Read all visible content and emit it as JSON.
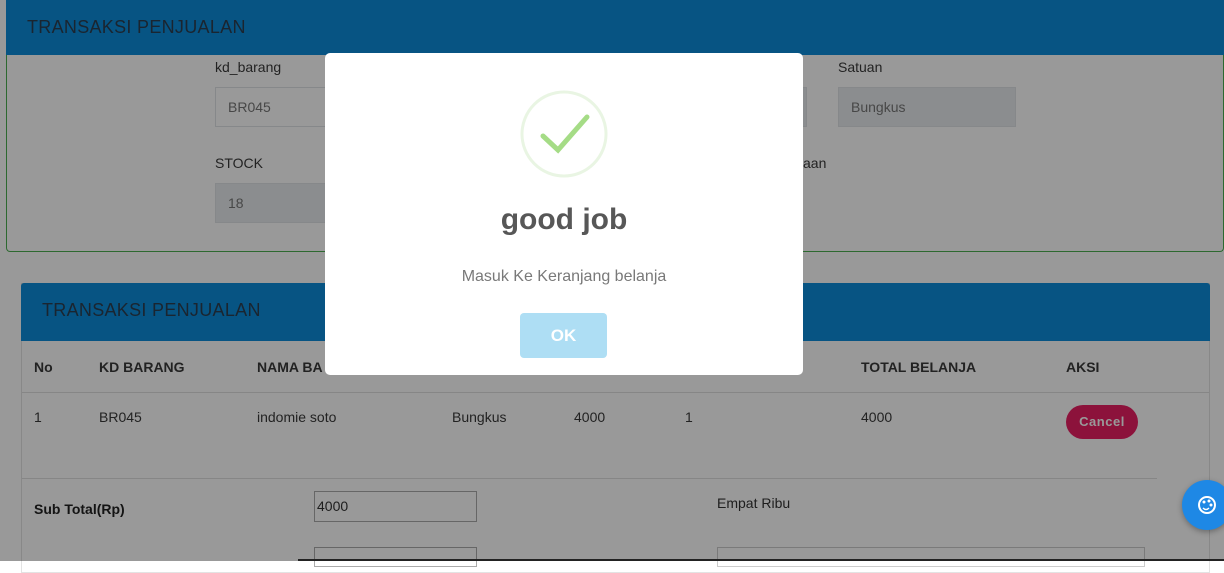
{
  "top_card": {
    "header_title": "TRANSAKSI PENJUALAN",
    "fields": {
      "kd_barang_label": "kd_barang",
      "kd_barang_value": "BR045",
      "satuan_label": "Satuan",
      "satuan_value": "Bungkus",
      "stock_label": "STOCK",
      "stock_value": "18",
      "partial_label": "aan"
    }
  },
  "cart_card": {
    "header_title": "TRANSAKSI PENJUALAN",
    "columns": [
      "No",
      "KD BARANG",
      "NAMA BA",
      "TOTAL BELANJA",
      "AKSI"
    ],
    "rows": [
      {
        "no": "1",
        "kd_barang": "BR045",
        "nama_barang": "indomie soto",
        "satuan": "Bungkus",
        "harga": "4000",
        "jumlah": "1",
        "total": "4000",
        "action": "Cancel"
      }
    ],
    "subtotal_label": "Sub Total(Rp)",
    "subtotal_value": "4000",
    "terbilang": "Empat Ribu"
  },
  "modal": {
    "title": "good job",
    "text": "Masuk Ke Keranjang belanja",
    "ok_label": "OK",
    "icon": "success-check-icon"
  },
  "fab": {
    "icon": "palette-icon"
  },
  "colors": {
    "header_blue": "#0d8ddb",
    "cancel_pink": "#e91e63",
    "ok_button": "#aedef4",
    "check_green": "#a5dc86",
    "fab_blue": "#1e88e5"
  }
}
